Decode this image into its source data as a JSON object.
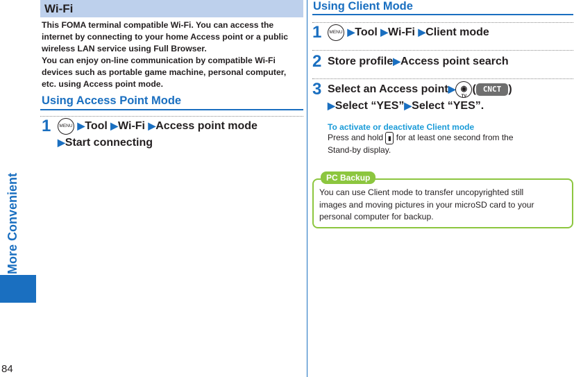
{
  "side_tab": {
    "label": "More Convenient",
    "color": "#1a6fc0"
  },
  "page_number": "84",
  "left": {
    "section_title": "Wi-Fi",
    "intro_lines": [
      "This FOMA terminal compatible Wi-Fi. You can access the",
      "internet by connecting to your home Access point or a public",
      "wireless LAN service using Full Browser.",
      "You can enjoy on-line communication by compatible Wi-Fi",
      "devices such as portable game machine, personal computer,",
      "etc. using Access point mode."
    ],
    "mode_title": "Using Access Point Mode",
    "step1": {
      "num": "1",
      "menu_key": "MENU",
      "items": [
        "Tool",
        "Wi-Fi",
        "Access point mode"
      ],
      "line2": "Start connecting"
    }
  },
  "right": {
    "mode_title": "Using Client Mode",
    "step1": {
      "num": "1",
      "menu_key": "MENU",
      "items": [
        "Tool",
        "Wi-Fi",
        "Client mode"
      ]
    },
    "step2": {
      "num": "2",
      "text_a": "Store profile",
      "text_b": "Access point search"
    },
    "step3": {
      "num": "3",
      "text_a": "Select an Access point",
      "key_label": "TV",
      "cnct_label": "CNCT",
      "line2_a": "Select “YES”",
      "line2_b": "Select “YES”."
    },
    "note_title": "To activate or deactivate Client mode",
    "note_line1_a": "Press and hold",
    "note_line1_b": "for at least one second from the",
    "note_line2": "Stand-by display.",
    "pc_badge": "PC Backup",
    "pc_lines": [
      "You can use Client mode to transfer uncopyrighted still",
      "images and moving pictures in your microSD card to your",
      "personal computer for backup."
    ]
  }
}
